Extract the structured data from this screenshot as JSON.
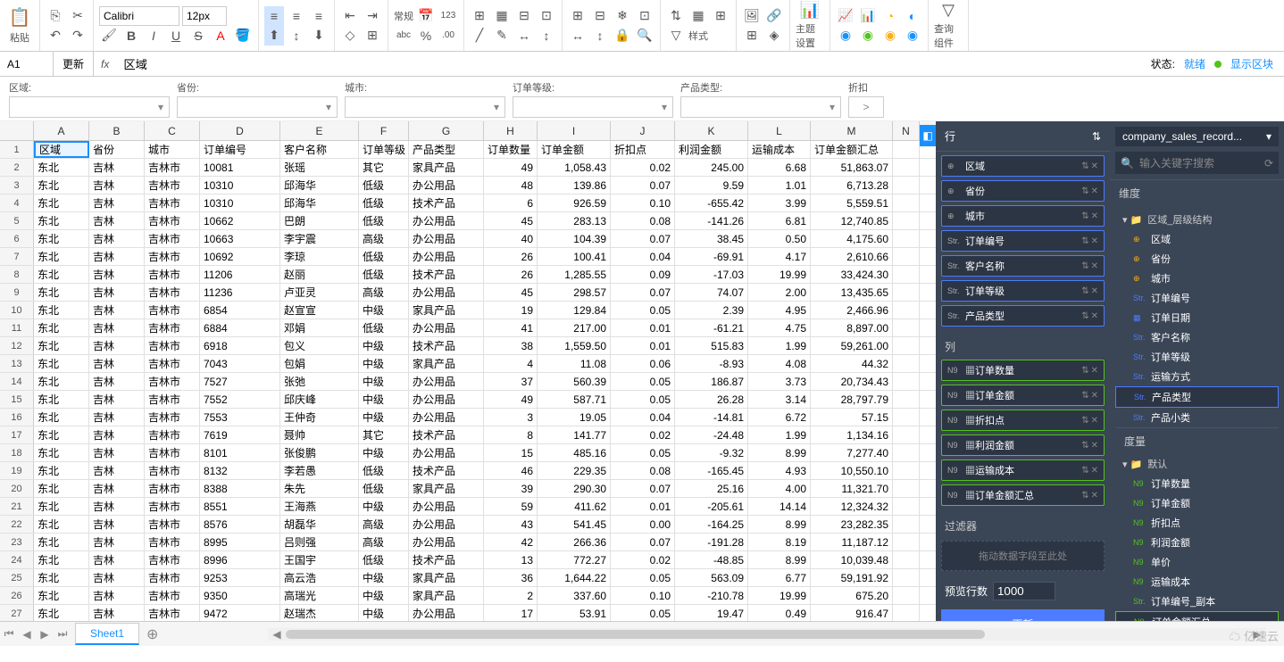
{
  "toolbar": {
    "paste": "粘贴",
    "font": "Calibri",
    "size": "12px",
    "normal": "常规",
    "style": "样式",
    "theme": "主题设置",
    "query": "查询组件"
  },
  "formulaBar": {
    "cellRef": "A1",
    "update": "更新",
    "formula": "区域"
  },
  "status": {
    "label": "状态:",
    "ready": "就绪",
    "showBlock": "显示区块"
  },
  "filters": [
    {
      "label": "区域:"
    },
    {
      "label": "省份:"
    },
    {
      "label": "城市:"
    },
    {
      "label": "订单等级:"
    },
    {
      "label": "产品类型:"
    },
    {
      "label": "折扣"
    }
  ],
  "discountOp": ">",
  "columns": [
    "A",
    "B",
    "C",
    "D",
    "E",
    "F",
    "G",
    "H",
    "I",
    "J",
    "K",
    "L",
    "M",
    "N"
  ],
  "headers": [
    "区域",
    "省份",
    "城市",
    "订单编号",
    "客户名称",
    "订单等级",
    "产品类型",
    "订单数量",
    "订单金额",
    "折扣点",
    "利润金额",
    "运输成本",
    "订单金额汇总"
  ],
  "rows": [
    [
      "东北",
      "吉林",
      "吉林市",
      "10081",
      "张瑶",
      "其它",
      "家具产品",
      "49",
      "1,058.43",
      "0.02",
      "245.00",
      "6.68",
      "51,863.07"
    ],
    [
      "东北",
      "吉林",
      "吉林市",
      "10310",
      "邱海华",
      "低级",
      "办公用品",
      "48",
      "139.86",
      "0.07",
      "9.59",
      "1.01",
      "6,713.28"
    ],
    [
      "东北",
      "吉林",
      "吉林市",
      "10310",
      "邱海华",
      "低级",
      "技术产品",
      "6",
      "926.59",
      "0.10",
      "-655.42",
      "3.99",
      "5,559.51"
    ],
    [
      "东北",
      "吉林",
      "吉林市",
      "10662",
      "巴朗",
      "低级",
      "办公用品",
      "45",
      "283.13",
      "0.08",
      "-141.26",
      "6.81",
      "12,740.85"
    ],
    [
      "东北",
      "吉林",
      "吉林市",
      "10663",
      "李宇震",
      "高级",
      "办公用品",
      "40",
      "104.39",
      "0.07",
      "38.45",
      "0.50",
      "4,175.60"
    ],
    [
      "东北",
      "吉林",
      "吉林市",
      "10692",
      "李琼",
      "低级",
      "办公用品",
      "26",
      "100.41",
      "0.04",
      "-69.91",
      "4.17",
      "2,610.66"
    ],
    [
      "东北",
      "吉林",
      "吉林市",
      "11206",
      "赵丽",
      "低级",
      "技术产品",
      "26",
      "1,285.55",
      "0.09",
      "-17.03",
      "19.99",
      "33,424.30"
    ],
    [
      "东北",
      "吉林",
      "吉林市",
      "11236",
      "卢亚灵",
      "高级",
      "办公用品",
      "45",
      "298.57",
      "0.07",
      "74.07",
      "2.00",
      "13,435.65"
    ],
    [
      "东北",
      "吉林",
      "吉林市",
      "6854",
      "赵宣宣",
      "中级",
      "家具产品",
      "19",
      "129.84",
      "0.05",
      "2.39",
      "4.95",
      "2,466.96"
    ],
    [
      "东北",
      "吉林",
      "吉林市",
      "6884",
      "邓娟",
      "低级",
      "办公用品",
      "41",
      "217.00",
      "0.01",
      "-61.21",
      "4.75",
      "8,897.00"
    ],
    [
      "东北",
      "吉林",
      "吉林市",
      "6918",
      "包义",
      "中级",
      "技术产品",
      "38",
      "1,559.50",
      "0.01",
      "515.83",
      "1.99",
      "59,261.00"
    ],
    [
      "东北",
      "吉林",
      "吉林市",
      "7043",
      "包娟",
      "中级",
      "家具产品",
      "4",
      "11.08",
      "0.06",
      "-8.93",
      "4.08",
      "44.32"
    ],
    [
      "东北",
      "吉林",
      "吉林市",
      "7527",
      "张弛",
      "中级",
      "办公用品",
      "37",
      "560.39",
      "0.05",
      "186.87",
      "3.73",
      "20,734.43"
    ],
    [
      "东北",
      "吉林",
      "吉林市",
      "7552",
      "邱庆峰",
      "中级",
      "办公用品",
      "49",
      "587.71",
      "0.05",
      "26.28",
      "3.14",
      "28,797.79"
    ],
    [
      "东北",
      "吉林",
      "吉林市",
      "7553",
      "王仲奇",
      "中级",
      "办公用品",
      "3",
      "19.05",
      "0.04",
      "-14.81",
      "6.72",
      "57.15"
    ],
    [
      "东北",
      "吉林",
      "吉林市",
      "7619",
      "聂帅",
      "其它",
      "技术产品",
      "8",
      "141.77",
      "0.02",
      "-24.48",
      "1.99",
      "1,134.16"
    ],
    [
      "东北",
      "吉林",
      "吉林市",
      "8101",
      "张俊鹏",
      "中级",
      "办公用品",
      "15",
      "485.16",
      "0.05",
      "-9.32",
      "8.99",
      "7,277.40"
    ],
    [
      "东北",
      "吉林",
      "吉林市",
      "8132",
      "李若愚",
      "低级",
      "技术产品",
      "46",
      "229.35",
      "0.08",
      "-165.45",
      "4.93",
      "10,550.10"
    ],
    [
      "东北",
      "吉林",
      "吉林市",
      "8388",
      "朱先",
      "低级",
      "家具产品",
      "39",
      "290.30",
      "0.07",
      "25.16",
      "4.00",
      "11,321.70"
    ],
    [
      "东北",
      "吉林",
      "吉林市",
      "8551",
      "王海燕",
      "中级",
      "办公用品",
      "59",
      "411.62",
      "0.01",
      "-205.61",
      "14.14",
      "12,324.32"
    ],
    [
      "东北",
      "吉林",
      "吉林市",
      "8576",
      "胡磊华",
      "高级",
      "办公用品",
      "43",
      "541.45",
      "0.00",
      "-164.25",
      "8.99",
      "23,282.35"
    ],
    [
      "东北",
      "吉林",
      "吉林市",
      "8995",
      "吕则强",
      "高级",
      "办公用品",
      "42",
      "266.36",
      "0.07",
      "-191.28",
      "8.19",
      "11,187.12"
    ],
    [
      "东北",
      "吉林",
      "吉林市",
      "8996",
      "王国宇",
      "低级",
      "技术产品",
      "13",
      "772.27",
      "0.02",
      "-48.85",
      "8.99",
      "10,039.48"
    ],
    [
      "东北",
      "吉林",
      "吉林市",
      "9253",
      "高云浩",
      "中级",
      "家具产品",
      "36",
      "1,644.22",
      "0.05",
      "563.09",
      "6.77",
      "59,191.92"
    ],
    [
      "东北",
      "吉林",
      "吉林市",
      "9350",
      "高瑞光",
      "中级",
      "家具产品",
      "2",
      "337.60",
      "0.10",
      "-210.78",
      "19.99",
      "675.20"
    ],
    [
      "东北",
      "吉林",
      "吉林市",
      "9472",
      "赵瑞杰",
      "中级",
      "办公用品",
      "17",
      "53.91",
      "0.05",
      "19.47",
      "0.49",
      "916.47"
    ]
  ],
  "configPanel": {
    "rowLabel": "行",
    "colLabel": "列",
    "filterLabel": "过滤器",
    "filterDrop": "拖动数据字段至此处",
    "previewLabel": "预览行数",
    "previewValue": "1000",
    "updateBtn": "更新",
    "rowFields": [
      {
        "icon": "⊕",
        "label": "区域",
        "type": "dim"
      },
      {
        "icon": "⊕",
        "label": "省份",
        "type": "dim"
      },
      {
        "icon": "⊕",
        "label": "城市",
        "type": "dim"
      },
      {
        "icon": "Str.",
        "label": "订单编号",
        "type": "dim"
      },
      {
        "icon": "Str.",
        "label": "客户名称",
        "type": "dim"
      },
      {
        "icon": "Str.",
        "label": "订单等级",
        "type": "dim"
      },
      {
        "icon": "Str.",
        "label": "产品类型",
        "type": "dim"
      }
    ],
    "colFields": [
      {
        "icon": "N9",
        "label": "▦订单数量",
        "type": "meas"
      },
      {
        "icon": "N9",
        "label": "▦订单金额",
        "type": "meas"
      },
      {
        "icon": "N9",
        "label": "▦折扣点",
        "type": "meas"
      },
      {
        "icon": "N9",
        "label": "▦利润金额",
        "type": "meas"
      },
      {
        "icon": "N9",
        "label": "▦运输成本",
        "type": "meas"
      },
      {
        "icon": "N9",
        "label": "▦订单金额汇总",
        "type": "meas"
      }
    ]
  },
  "dataPanel": {
    "source": "company_sales_record...",
    "searchPlaceholder": "输入关键字搜索",
    "dimLabel": "维度",
    "measLabel": "度量",
    "dimGroup": "区域_层级结构",
    "defaultGroup": "默认",
    "dims": [
      {
        "icon": "⊕",
        "label": "区域",
        "cls": "geo"
      },
      {
        "icon": "⊕",
        "label": "省份",
        "cls": "geo"
      },
      {
        "icon": "⊕",
        "label": "城市",
        "cls": "geo"
      },
      {
        "icon": "Str.",
        "label": "订单编号",
        "cls": "str"
      },
      {
        "icon": "▦",
        "label": "订单日期",
        "cls": "str"
      },
      {
        "icon": "Str.",
        "label": "客户名称",
        "cls": "str"
      },
      {
        "icon": "Str.",
        "label": "订单等级",
        "cls": "str"
      },
      {
        "icon": "Str.",
        "label": "运输方式",
        "cls": "str"
      },
      {
        "icon": "Str.",
        "label": "产品类型",
        "cls": "str",
        "sel": true
      },
      {
        "icon": "Str.",
        "label": "产品小类",
        "cls": "str"
      }
    ],
    "meas": [
      {
        "icon": "N9",
        "label": "订单数量"
      },
      {
        "icon": "N9",
        "label": "订单金额"
      },
      {
        "icon": "N9",
        "label": "折扣点"
      },
      {
        "icon": "N9",
        "label": "利润金额"
      },
      {
        "icon": "N9",
        "label": "单价"
      },
      {
        "icon": "N9",
        "label": "运输成本"
      },
      {
        "icon": "Str.",
        "label": "订单编号_副本"
      },
      {
        "icon": "N9",
        "label": "订单金额汇总",
        "sel": "green"
      }
    ]
  },
  "tabs": {
    "sheet": "Sheet1"
  },
  "logo": "亿速云"
}
